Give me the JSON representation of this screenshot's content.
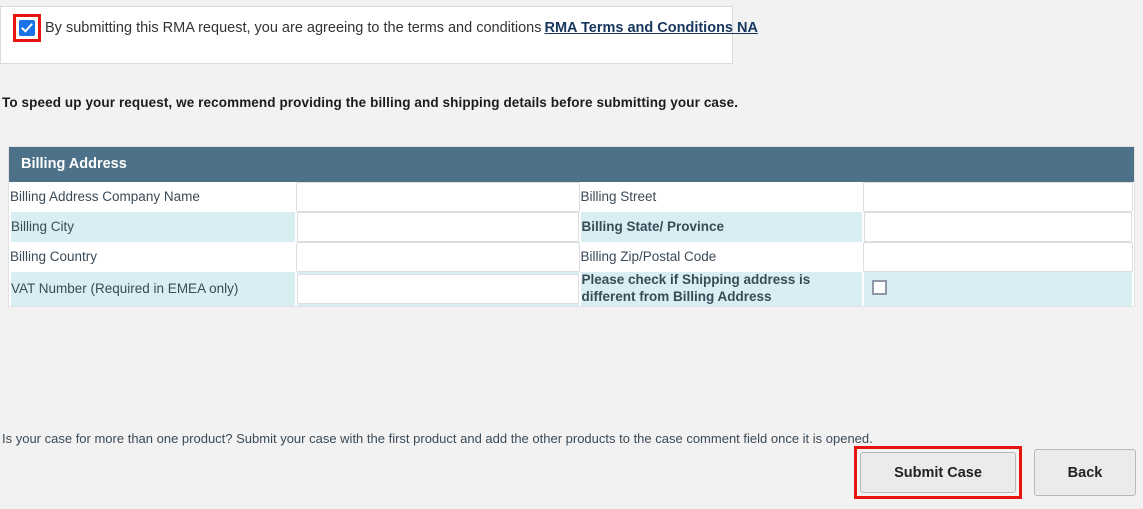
{
  "agreement": {
    "checkbox_state": "checked",
    "text": "By submitting this RMA request, you are agreeing to the terms and conditions",
    "link_label": "RMA Terms and Conditions NA"
  },
  "speedup_note": "To speed up your request, we recommend providing the billing and shipping details before submitting your case.",
  "billing_panel": {
    "header": "Billing Address",
    "rows": [
      {
        "left_label": "Billing Address Company Name",
        "left_value": "",
        "right_label": "Billing Street",
        "right_value": ""
      },
      {
        "left_label": "Billing City",
        "left_value": "",
        "right_label": "Billing State/ Province",
        "right_value": ""
      },
      {
        "left_label": "Billing Country",
        "left_value": "",
        "right_label": "Billing Zip/Postal Code",
        "right_value": ""
      },
      {
        "left_label": "VAT Number (Required in EMEA only)",
        "left_value": "",
        "right_label": "Please check if Shipping address is different from Billing Address",
        "right_checkbox_state": "unchecked"
      }
    ]
  },
  "footer_note": "Is your case for more than one product? Submit your case with the first product and add the other products to the case comment field once it is opened.",
  "buttons": {
    "submit_label": "Submit Case",
    "back_label": "Back"
  },
  "colors": {
    "page_background": "#f2f2f2",
    "panel_header": "#4d7189",
    "alt_row": "#d9eef3",
    "highlight_red": "#e8140f",
    "link_navy": "#17365d",
    "checkbox_blue": "#1a73e8"
  }
}
